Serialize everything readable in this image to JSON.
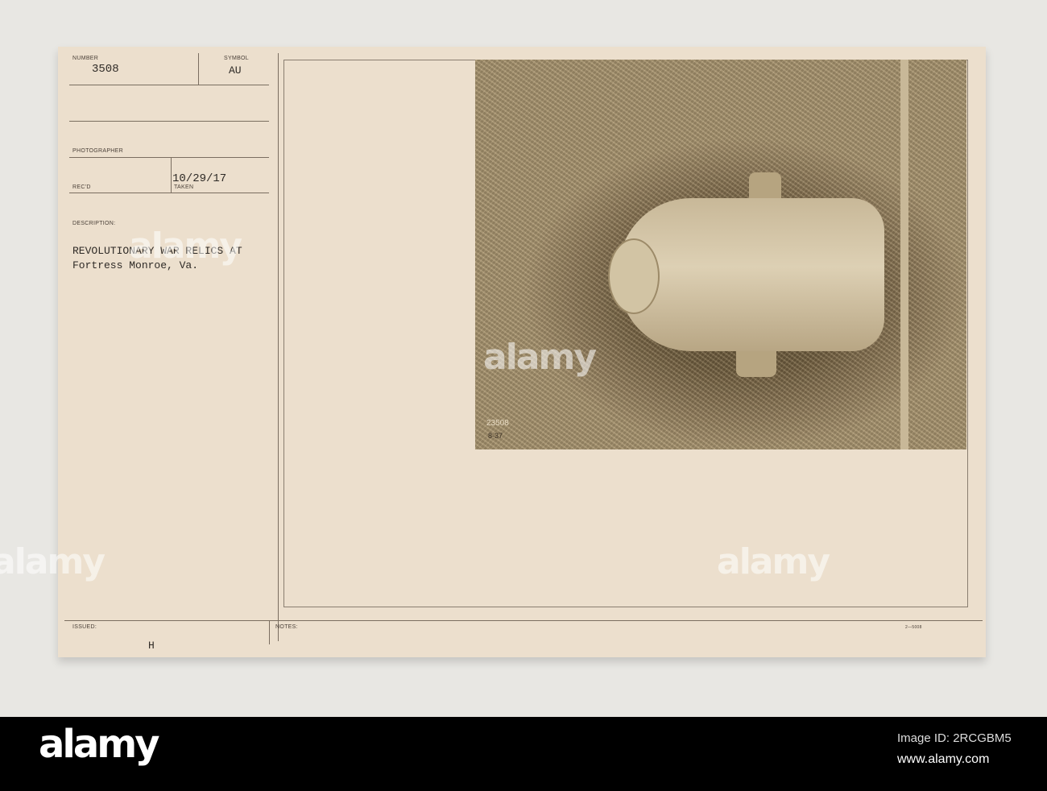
{
  "card": {
    "number_label": "NUMBER",
    "number": "3508",
    "symbol_label": "SYMBOL",
    "symbol": "AU",
    "photographer_label": "PHOTOGRAPHER",
    "recd_label": "REC'D",
    "taken_date": "10/29/17",
    "taken_label": "TAKEN",
    "description_label": "DESCRIPTION:",
    "description_line1": "REVOLUTIONARY WAR RELICS AT",
    "description_line2": "Fortress Monroe, Va.",
    "issued_label": "ISSUED:",
    "issued_value": "H",
    "notes_label": "NOTES:",
    "form_code": "2—5008",
    "photo_number": "23508",
    "photo_code": "8-37"
  },
  "watermark": "alamy",
  "footer": {
    "logo": "alamy",
    "image_id": "Image ID: 2RCGBM5",
    "url": "www.alamy.com"
  }
}
